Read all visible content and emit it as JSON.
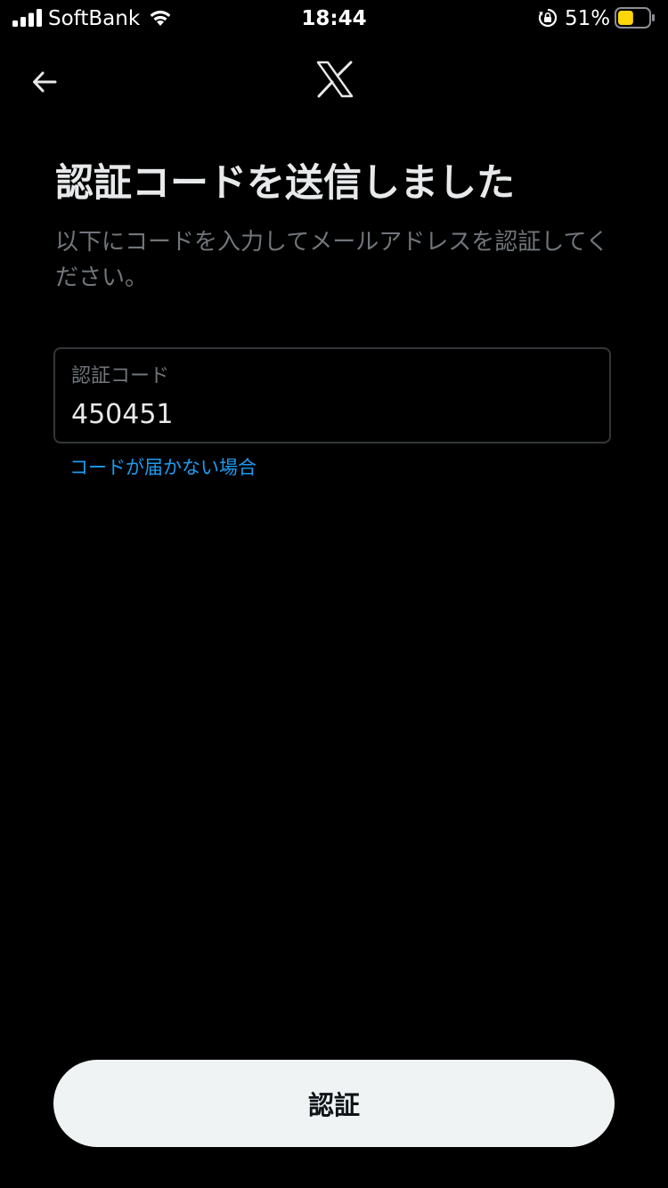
{
  "status_bar": {
    "carrier": "SoftBank",
    "time": "18:44",
    "battery_percent": "51%",
    "battery_level": 0.51,
    "battery_color": "#ffd60a",
    "icons": [
      "signal-icon",
      "wifi-icon",
      "orientation-lock-icon",
      "battery-icon"
    ]
  },
  "header": {
    "back_icon": "arrow-left-icon",
    "logo_icon": "x-logo-icon"
  },
  "content": {
    "title": "認証コードを送信しました",
    "subtitle": "以下にコードを入力してメールアドレスを認証してください。",
    "code_field": {
      "label": "認証コード",
      "value": "450451"
    },
    "help_link": "コードが届かない場合"
  },
  "footer": {
    "verify_label": "認証"
  },
  "colors": {
    "background": "#000000",
    "primary_text": "#e7e9ea",
    "secondary_text": "#71767b",
    "link": "#1d9bf0",
    "field_border": "#333639",
    "button_bg": "#eff3f4",
    "button_text": "#0f1419"
  }
}
